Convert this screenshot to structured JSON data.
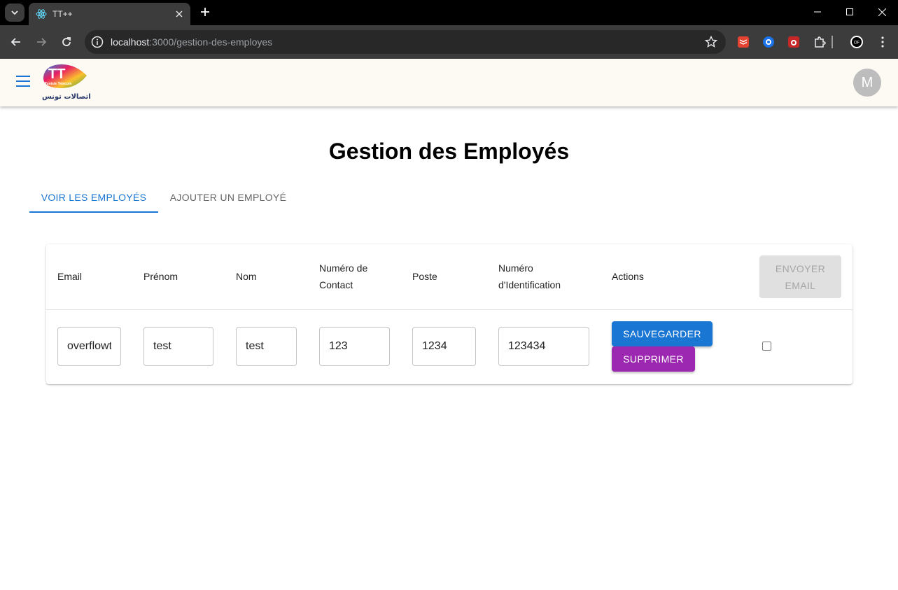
{
  "browser": {
    "tab_title": "TT++",
    "url_host": "localhost",
    "url_path": ":3000/gestion-des-employes"
  },
  "appbar": {
    "avatar_letter": "M",
    "logo_text_arabic": "اتصالات تونس",
    "logo_text_latin": "Tunisie Telecom"
  },
  "page": {
    "title": "Gestion des Employés",
    "tabs": [
      {
        "label": "VOIR LES EMPLOYÉS",
        "active": true
      },
      {
        "label": "AJOUTER UN EMPLOYÉ",
        "active": false
      }
    ]
  },
  "table": {
    "headers": {
      "email": "Email",
      "prenom": "Prénom",
      "nom": "Nom",
      "contact_line1": "Numéro de",
      "contact_line2": "Contact",
      "poste": "Poste",
      "ident_line1": "Numéro",
      "ident_line2": "d'Identification",
      "actions": "Actions"
    },
    "send_email_line1": "ENVOYER",
    "send_email_line2": "EMAIL",
    "rows": [
      {
        "email": "overflowtest",
        "prenom": "test",
        "nom": "test",
        "contact": "123",
        "poste": "1234",
        "identification": "123434",
        "save_label": "SAUVEGARDER",
        "delete_label": "SUPPRIMER",
        "selected": false
      }
    ]
  },
  "colors": {
    "primary": "#1976d2",
    "secondary": "#9c27b0",
    "appbar_bg": "#fdf9f3"
  }
}
